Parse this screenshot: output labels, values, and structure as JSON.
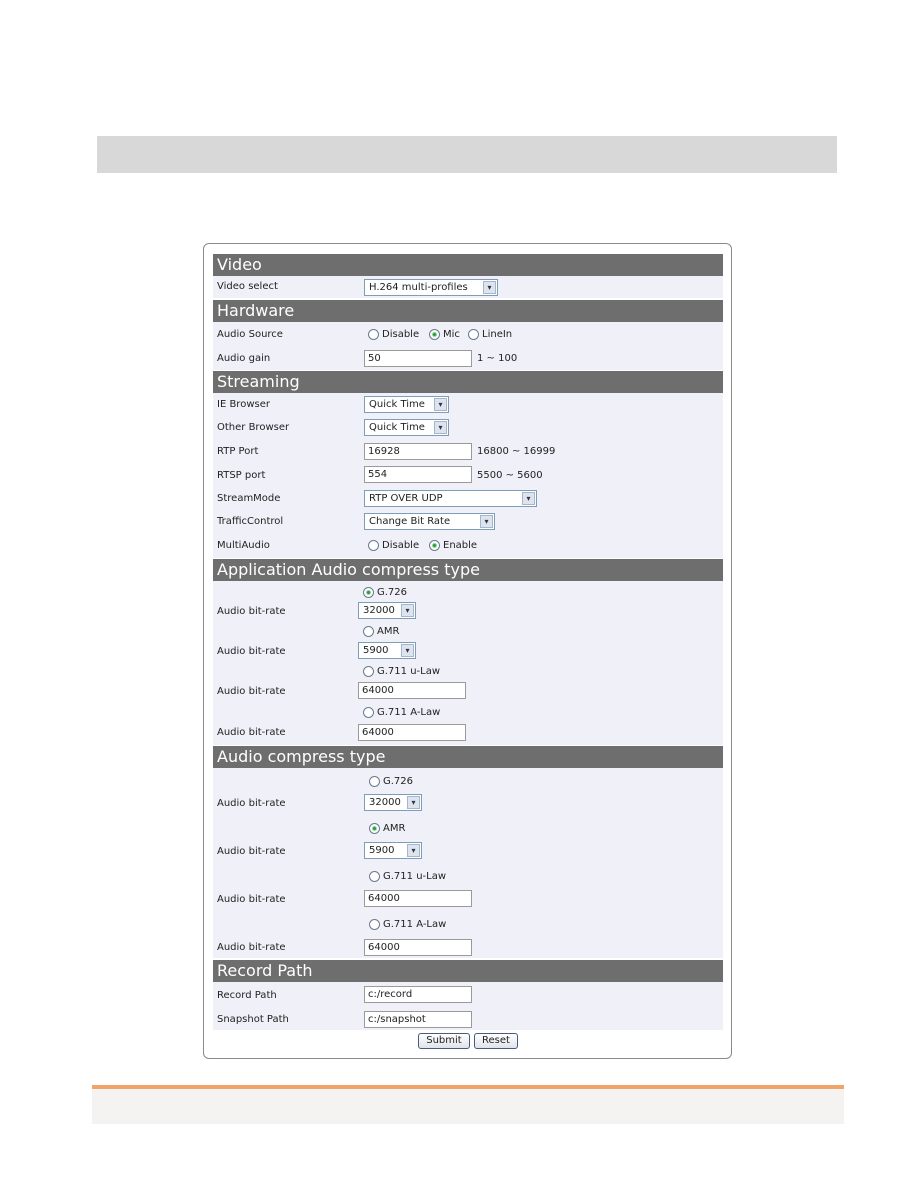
{
  "sections": {
    "video": {
      "title": "Video",
      "video_select": {
        "label": "Video select",
        "value": "H.264 multi-profiles"
      }
    },
    "hardware": {
      "title": "Hardware",
      "audio_source": {
        "label": "Audio Source",
        "options": [
          "Disable",
          "Mic",
          "LineIn"
        ],
        "selected": "Mic"
      },
      "audio_gain": {
        "label": "Audio gain",
        "value": "50",
        "range": "1 ~ 100"
      }
    },
    "streaming": {
      "title": "Streaming",
      "ie_browser": {
        "label": "IE Browser",
        "value": "Quick Time"
      },
      "other_browser": {
        "label": "Other Browser",
        "value": "Quick Time"
      },
      "rtp_port": {
        "label": "RTP Port",
        "value": "16928",
        "range": "16800 ~ 16999"
      },
      "rtsp_port": {
        "label": "RTSP port",
        "value": "554",
        "range": "5500 ~ 5600"
      },
      "stream_mode": {
        "label": "StreamMode",
        "value": "RTP OVER UDP"
      },
      "traffic_control": {
        "label": "TrafficControl",
        "value": "Change Bit Rate"
      },
      "multi_audio": {
        "label": "MultiAudio",
        "options": [
          "Disable",
          "Enable"
        ],
        "selected": "Enable"
      }
    },
    "app_audio": {
      "title": "Application Audio compress type",
      "bitrate_label": "Audio bit-rate",
      "codecs": [
        {
          "name": "G.726",
          "selected": true,
          "bitrate": "32000",
          "kind": "select"
        },
        {
          "name": "AMR",
          "selected": false,
          "bitrate": "5900",
          "kind": "select"
        },
        {
          "name": "G.711 u-Law",
          "selected": false,
          "bitrate": "64000",
          "kind": "input"
        },
        {
          "name": "G.711 A-Law",
          "selected": false,
          "bitrate": "64000",
          "kind": "input"
        }
      ]
    },
    "audio_compress": {
      "title": "Audio compress type",
      "bitrate_label": "Audio bit-rate",
      "codecs": [
        {
          "name": "G.726",
          "selected": false,
          "bitrate": "32000",
          "kind": "select"
        },
        {
          "name": "AMR",
          "selected": true,
          "bitrate": "5900",
          "kind": "select"
        },
        {
          "name": "G.711 u-Law",
          "selected": false,
          "bitrate": "64000",
          "kind": "input"
        },
        {
          "name": "G.711 A-Law",
          "selected": false,
          "bitrate": "64000",
          "kind": "input"
        }
      ]
    },
    "record_path": {
      "title": "Record Path",
      "record_path": {
        "label": "Record Path",
        "value": "c:/record"
      },
      "snapshot_path": {
        "label": "Snapshot Path",
        "value": "c:/snapshot"
      }
    }
  },
  "buttons": {
    "submit": "Submit",
    "reset": "Reset"
  },
  "icons": {
    "dropdown": "▾"
  }
}
